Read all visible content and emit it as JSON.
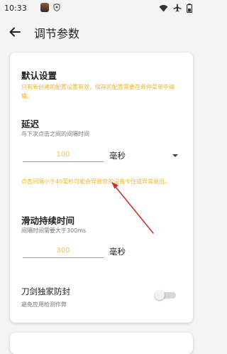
{
  "status_bar": {
    "time": "10:33",
    "icons": [
      "avatar-icon",
      "shield-icon",
      "wifi-icon",
      "airplane-icon",
      "battery-icon"
    ]
  },
  "appbar": {
    "title": "调节参数",
    "back_icon": "arrow-back-icon"
  },
  "default_settings": {
    "title": "默认设置",
    "note": "只有新创建的配置设置有效，保存的配置需要在悬停菜单中编辑。"
  },
  "delay": {
    "title": "延迟",
    "subtitle": "与下次点击之间的间隔时间",
    "value": "100",
    "unit": "毫秒",
    "warning": "点击间隔小于40毫秒可能会导致您的设备卡住或异常退出。"
  },
  "swipe_duration": {
    "title": "滑动持续时间",
    "subtitle": "间隔时间需要大于300ms",
    "value": "300",
    "unit": "毫秒"
  },
  "anti_detect": {
    "title": "刀剑独家防封",
    "subtitle": "避免应用检测作弊",
    "enabled": false
  },
  "colors": {
    "accent_yellow": "#f5c542",
    "note_yellow": "#f0b429",
    "annotation_red": "#c8352e",
    "toggle_off": "#d6d6d6"
  }
}
